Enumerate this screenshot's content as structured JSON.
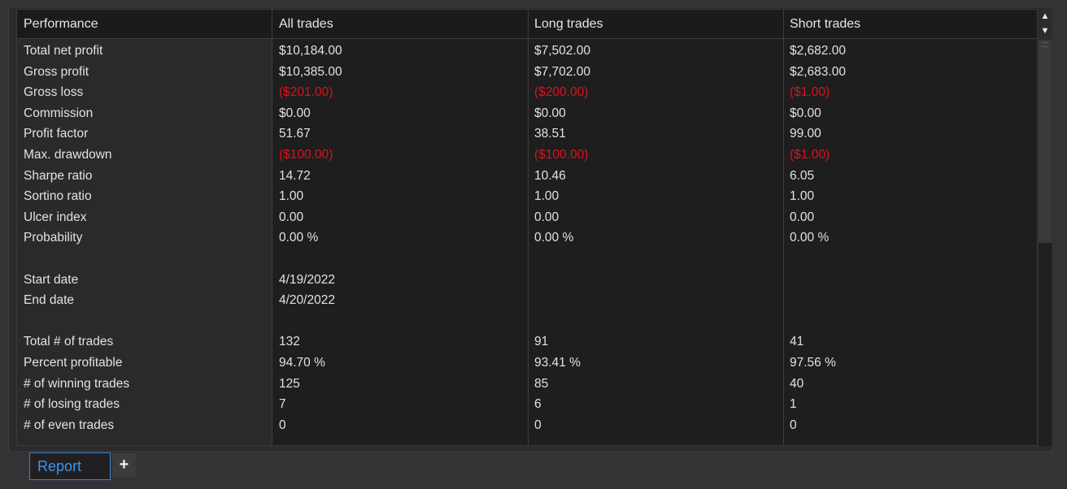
{
  "header": {
    "col0": "Performance",
    "col1": "All trades",
    "col2": "Long trades",
    "col3": "Short trades"
  },
  "rows": [
    {
      "label": "Total net profit",
      "all": "$10,184.00",
      "long": "$7,502.00",
      "short": "$2,682.00",
      "negative": false
    },
    {
      "label": "Gross profit",
      "all": "$10,385.00",
      "long": "$7,702.00",
      "short": "$2,683.00",
      "negative": false
    },
    {
      "label": "Gross loss",
      "all": "($201.00)",
      "long": "($200.00)",
      "short": "($1.00)",
      "negative": true
    },
    {
      "label": "Commission",
      "all": "$0.00",
      "long": "$0.00",
      "short": "$0.00",
      "negative": false
    },
    {
      "label": "Profit factor",
      "all": "51.67",
      "long": "38.51",
      "short": "99.00",
      "negative": false
    },
    {
      "label": "Max. drawdown",
      "all": "($100.00)",
      "long": "($100.00)",
      "short": "($1.00)",
      "negative": true
    },
    {
      "label": "Sharpe ratio",
      "all": "14.72",
      "long": "10.46",
      "short": "6.05",
      "negative": false
    },
    {
      "label": "Sortino ratio",
      "all": "1.00",
      "long": "1.00",
      "short": "1.00",
      "negative": false
    },
    {
      "label": "Ulcer index",
      "all": "0.00",
      "long": "0.00",
      "short": "0.00",
      "negative": false
    },
    {
      "label": "Probability",
      "all": "0.00 %",
      "long": "0.00 %",
      "short": "0.00 %",
      "negative": false
    },
    {
      "label": "",
      "all": "",
      "long": "",
      "short": "",
      "negative": false
    },
    {
      "label": "Start date",
      "all": "4/19/2022",
      "long": "",
      "short": "",
      "negative": false
    },
    {
      "label": "End date",
      "all": "4/20/2022",
      "long": "",
      "short": "",
      "negative": false
    },
    {
      "label": "",
      "all": "",
      "long": "",
      "short": "",
      "negative": false
    },
    {
      "label": "Total # of trades",
      "all": "132",
      "long": "91",
      "short": "41",
      "negative": false
    },
    {
      "label": "Percent profitable",
      "all": "94.70 %",
      "long": "93.41 %",
      "short": "97.56 %",
      "negative": false
    },
    {
      "label": "# of winning trades",
      "all": "125",
      "long": "85",
      "short": "40",
      "negative": false
    },
    {
      "label": "# of losing trades",
      "all": "7",
      "long": "6",
      "short": "1",
      "negative": false
    },
    {
      "label": "# of even trades",
      "all": "0",
      "long": "0",
      "short": "0",
      "negative": false
    }
  ],
  "colors": {
    "negative": "#e0101a",
    "tab_accent": "#3d95e8",
    "text": "#e2e2e2"
  },
  "scrollbar": {
    "up_icon": "triangle-up-icon",
    "down_icon": "triangle-down-icon"
  },
  "tabs": {
    "active_label": "Report",
    "add_label": "+"
  }
}
